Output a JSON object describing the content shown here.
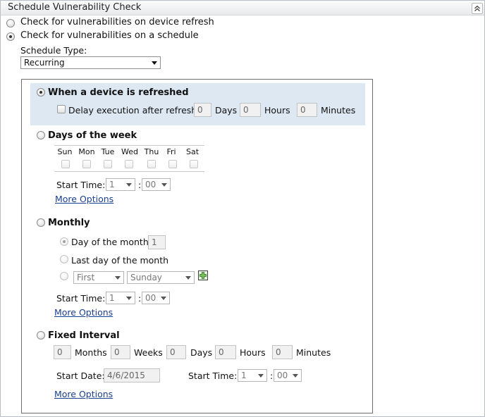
{
  "panel": {
    "title": "Schedule Vulnerability Check",
    "collapse_icon": "double-chevron-up-icon"
  },
  "options": {
    "on_refresh": "Check for vulnerabilities on device refresh",
    "on_schedule": "Check for vulnerabilities on a schedule",
    "selected": "on_schedule"
  },
  "schedule_type": {
    "label": "Schedule Type:",
    "value": "Recurring"
  },
  "refresh": {
    "title": "When a device is refreshed",
    "selected": true,
    "delay_label": "Delay execution after refresh:",
    "days_value": "0",
    "days_label": "Days",
    "hours_value": "0",
    "hours_label": "Hours",
    "minutes_value": "0",
    "minutes_label": "Minutes"
  },
  "weekly": {
    "title": "Days of the week",
    "days": [
      "Sun",
      "Mon",
      "Tue",
      "Wed",
      "Thu",
      "Fri",
      "Sat"
    ],
    "start_time_label": "Start Time:",
    "hour": "1",
    "minute": "00",
    "more_options": "More Options"
  },
  "monthly": {
    "title": "Monthly",
    "day_of_month_label": "Day of the month:",
    "day_of_month_value": "1",
    "last_day_label": "Last day of the month",
    "ordinal": "First",
    "weekday": "Sunday",
    "start_time_label": "Start Time:",
    "hour": "1",
    "minute": "00",
    "more_options": "More Options"
  },
  "fixed": {
    "title": "Fixed Interval",
    "months_value": "0",
    "months_label": "Months",
    "weeks_value": "0",
    "weeks_label": "Weeks",
    "days_value": "0",
    "days_label": "Days",
    "hours_value": "0",
    "hours_label": "Hours",
    "minutes_value": "0",
    "minutes_label": "Minutes",
    "start_date_label": "Start Date:",
    "start_date_value": "4/6/2015",
    "start_time_label": "Start Time:",
    "hour": "1",
    "minute": "00",
    "more_options": "More Options"
  },
  "time_separator": ":"
}
